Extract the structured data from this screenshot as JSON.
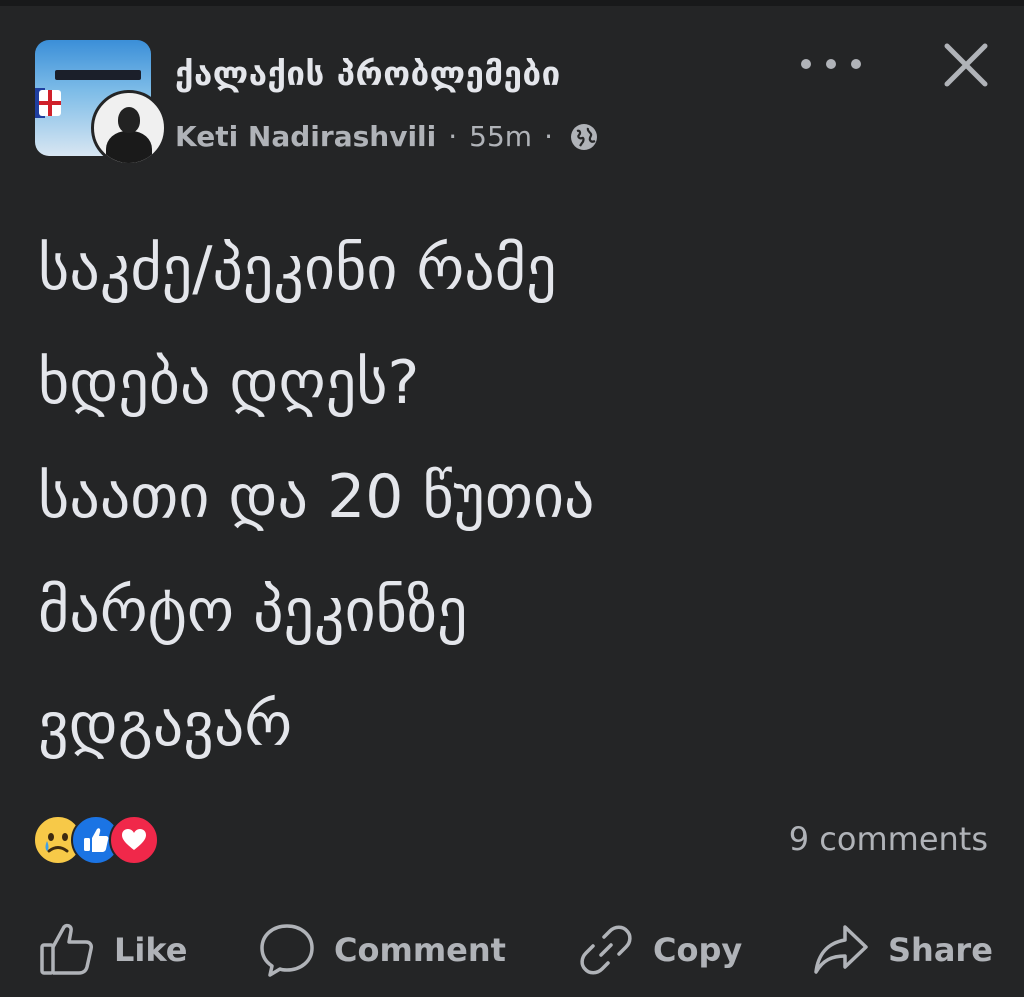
{
  "post": {
    "group_name": "ქალაქის პრობლემები",
    "author": "Keti Nadirashvili",
    "time": "55m",
    "separator": "·",
    "text": "საკძე/პეკინი რამე\nხდება დღეს?\nსაათი და 20 წუთია\nმარტო პეკინზე\nვდგავარ",
    "comments": "9 comments",
    "reactions": [
      "sad-icon",
      "like-icon",
      "love-icon"
    ]
  },
  "actions": {
    "like": "Like",
    "comment": "Comment",
    "copy": "Copy",
    "share": "Share"
  },
  "colors": {
    "background": "#242526",
    "text": "#e4e6eb",
    "secondary": "#b0b3b8",
    "like_blue": "#1b74e4",
    "love_red": "#f0284a"
  }
}
